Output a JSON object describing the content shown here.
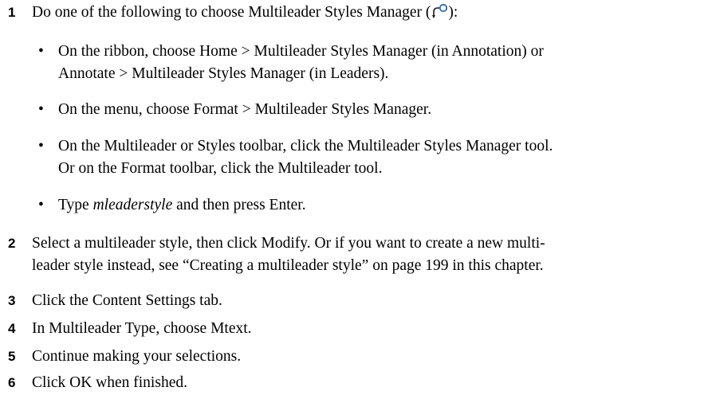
{
  "steps": [
    {
      "number": "1",
      "text_before_icon": "Do one of the following to choose Multileader Styles Manager (",
      "icon": "multileader-styles-manager-icon",
      "text_after_icon": "):"
    },
    {
      "number": "2",
      "line1": "Select a multileader style, then click Modify. Or if you want to create a new multi-",
      "line2": "leader style instead, see “Creating a multileader style” on page 199 in this chapter."
    },
    {
      "number": "3",
      "text": "Click the Content Settings tab."
    },
    {
      "number": "4",
      "text": "In Multileader Type, choose Mtext."
    },
    {
      "number": "5",
      "text": "Continue making your selections."
    },
    {
      "number": "6",
      "text": "Click OK when finished."
    }
  ],
  "bullets": [
    {
      "dot": "•",
      "line1": "On the ribbon, choose Home > Multileader Styles Manager (in Annotation) or",
      "line2": "Annotate > Multileader Styles Manager (in Leaders)."
    },
    {
      "dot": "•",
      "line1": "On the menu, choose Format > Multileader Styles Manager."
    },
    {
      "dot": "•",
      "line1": "On the Multileader or Styles toolbar, click the Multileader Styles Manager tool.",
      "line2": "Or on the Format toolbar, click the Multileader tool."
    },
    {
      "dot": "•",
      "prefix": "Type ",
      "italic": "mleaderstyle",
      "suffix": " and then press Enter."
    }
  ],
  "colors": {
    "text": "#000000",
    "icon_stroke": "#1a1a1a",
    "icon_circle": "#2b6cb0"
  }
}
